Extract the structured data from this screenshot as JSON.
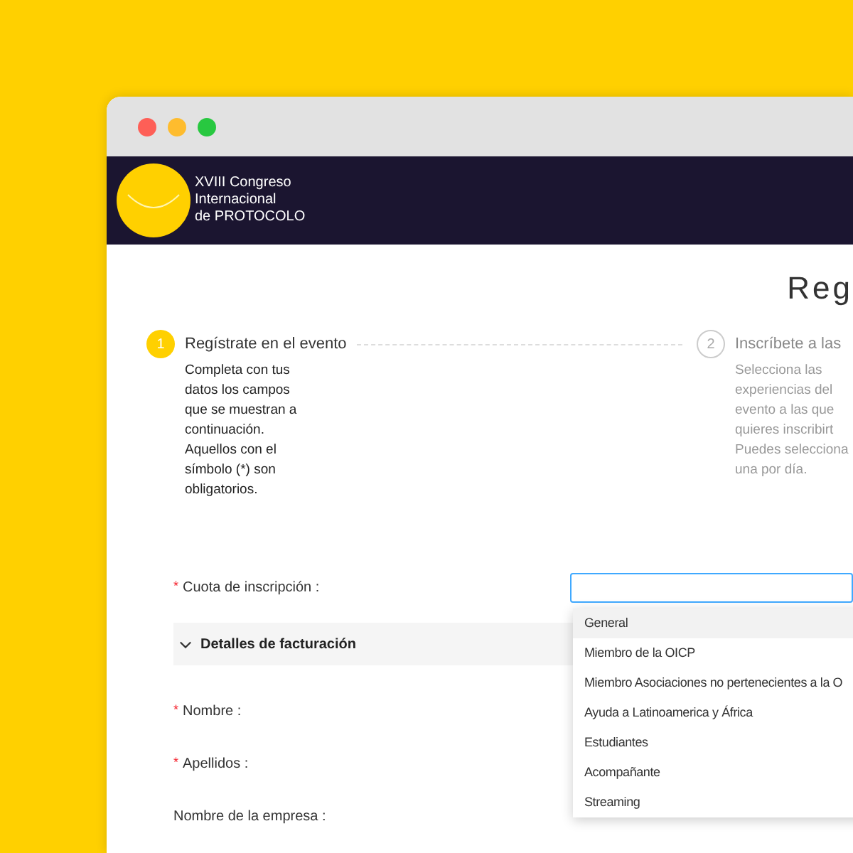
{
  "header": {
    "logo_text": [
      "XVIII Congreso",
      "Internacional",
      "de PROTOCOLO"
    ]
  },
  "page_title": "Reg",
  "steps": [
    {
      "number": "1",
      "title": "Regístrate en el evento",
      "description": [
        "Completa con tus",
        "datos los campos",
        "que se muestran a",
        "continuación.",
        "Aquellos con el",
        "símbolo (*) son",
        "obligatorios."
      ],
      "selected": true
    },
    {
      "number": "2",
      "title": "Inscríbete a las",
      "description": [
        "Selecciona las",
        "experiencias del",
        "evento a las que",
        "quieres inscribirt",
        "Puedes selecciona",
        "una por día."
      ],
      "selected": false
    }
  ],
  "form": {
    "fee": {
      "label": "Cuota de inscripción :",
      "marker": "*"
    },
    "section": {
      "title": "Detalles de facturación",
      "expanded": true
    },
    "fields": [
      {
        "label": "Nombre :",
        "marker": "*"
      },
      {
        "label": "Apellidos :",
        "marker": "*"
      },
      {
        "label": "Nombre de la empresa :"
      }
    ],
    "dropdown": [
      {
        "label": "General",
        "selected": true
      },
      {
        "label": "Miembro de la OICP",
        "selected": false
      },
      {
        "label": "Miembro Asociaciones no pertenecientes a la O",
        "selected": false
      },
      {
        "label": "Ayuda a Latinoamerica y África",
        "selected": false
      },
      {
        "label": "Estudiantes",
        "selected": false
      },
      {
        "label": "Acompañante",
        "selected": false
      },
      {
        "label": "Streaming",
        "selected": false
      }
    ]
  }
}
